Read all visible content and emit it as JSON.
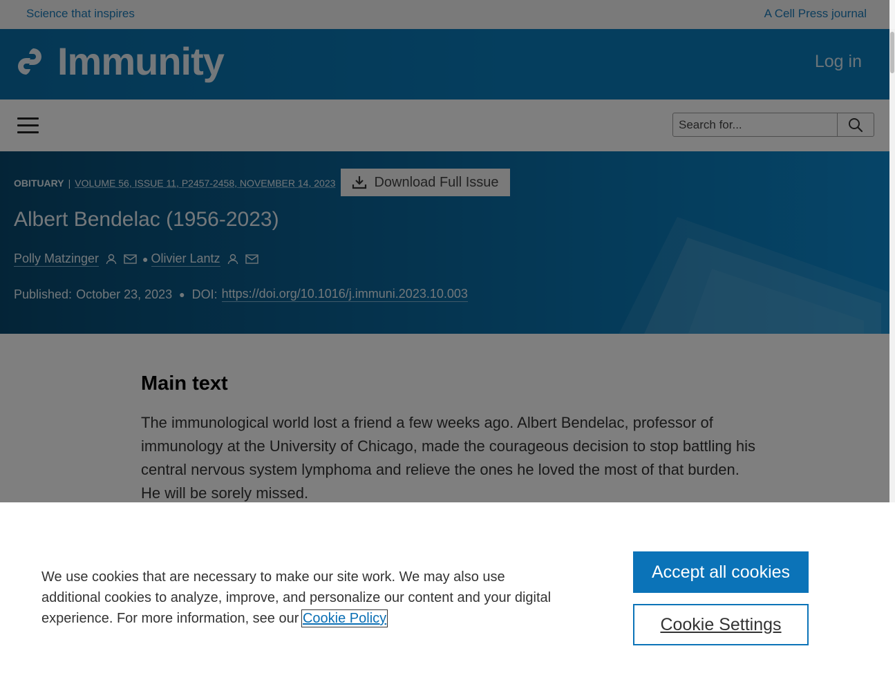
{
  "topbar": {
    "tagline": "Science that inspires",
    "journal_note": "A Cell Press journal"
  },
  "brand": {
    "logo_text": "Immunity",
    "login_label": "Log in"
  },
  "nav": {
    "search_placeholder": "Search for..."
  },
  "article": {
    "type": "OBITUARY",
    "separator": "|",
    "volume_info": "VOLUME 56, ISSUE 11, P2457-2458, NOVEMBER 14, 2023",
    "download_label": "Download Full Issue",
    "title": "Albert Bendelac (1956-2023)",
    "authors": [
      {
        "name": "Polly Matzinger"
      },
      {
        "name": "Olivier Lantz"
      }
    ],
    "published_label": "Published:",
    "published_date": "October 23, 2023",
    "doi_label": "DOI:",
    "doi": "https://doi.org/10.1016/j.immuni.2023.10.003"
  },
  "main": {
    "heading": "Main text",
    "paragraph": "The immunological world lost a friend a few weeks ago. Albert Bendelac, professor of immunology at the University of Chicago, made the courageous decision to stop battling his central nervous system lymphoma and relieve the ones he loved the most of that burden. He will be sorely missed."
  },
  "cookie": {
    "message": "We use cookies that are necessary to make our site work. We may also use additional cookies to analyze, improve, and personalize our content and your digital experience. For more information, see our",
    "policy_link": "Cookie Policy",
    "accept_label": "Accept all cookies",
    "settings_label": "Cookie Settings"
  },
  "colors": {
    "brand_blue": "#0b73b8",
    "link_blue": "#1a7bb9"
  },
  "icons": [
    "logo-mark",
    "menu-icon",
    "search-icon",
    "download-icon",
    "user-icon",
    "mail-icon"
  ]
}
